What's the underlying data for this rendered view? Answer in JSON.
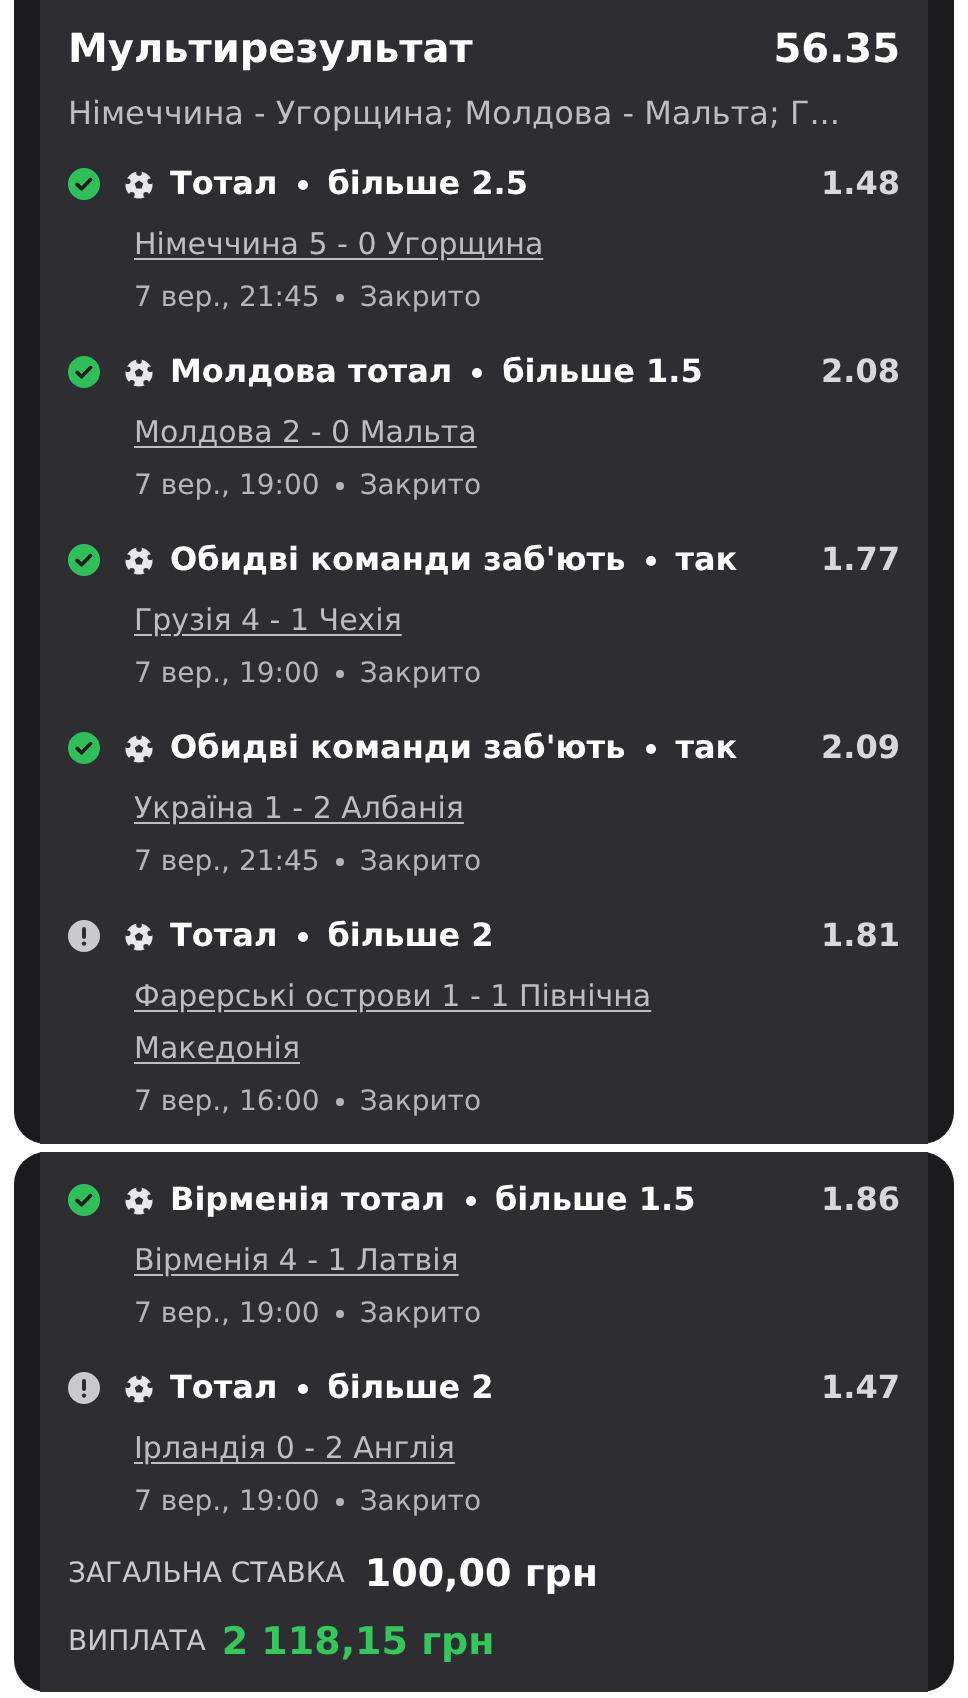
{
  "header": {
    "title": "Мультирезультат",
    "odds": "56.35",
    "subtitle": "Німеччина - Угорщина; Молдова - Мальта; Г..."
  },
  "cards": [
    {
      "selections": [
        {
          "won": true,
          "market": "Тотал",
          "pick": "більше 2.5",
          "odds": "1.48",
          "match": "Німеччина 5 - 0 Угорщина",
          "date": "7 вер., 21:45",
          "state": "Закрито"
        },
        {
          "won": true,
          "market": "Молдова тотал",
          "pick": "більше 1.5",
          "odds": "2.08",
          "match": "Молдова 2 - 0 Мальта",
          "date": "7 вер., 19:00",
          "state": "Закрито"
        },
        {
          "won": true,
          "market": "Обидві команди заб'ють",
          "pick": "так",
          "odds": "1.77",
          "match": "Грузія 4 - 1 Чехія",
          "date": "7 вер., 19:00",
          "state": "Закрито"
        },
        {
          "won": true,
          "market": "Обидві команди заб'ють",
          "pick": "так",
          "odds": "2.09",
          "match": "Україна 1 - 2 Албанія",
          "date": "7 вер., 21:45",
          "state": "Закрито"
        },
        {
          "won": false,
          "market": "Тотал",
          "pick": "більше 2",
          "odds": "1.81",
          "match": "Фарерські острови 1 - 1 Північна Македонія",
          "date": "7 вер., 16:00",
          "state": "Закрито"
        }
      ]
    },
    {
      "selections": [
        {
          "won": true,
          "market": "Вірменія тотал",
          "pick": "більше 1.5",
          "odds": "1.86",
          "match": "Вірменія 4 - 1 Латвія",
          "date": "7 вер., 19:00",
          "state": "Закрито"
        },
        {
          "won": false,
          "market": "Тотал",
          "pick": "більше 2",
          "odds": "1.47",
          "match": "Ірландія 0 - 2 Англія",
          "date": "7 вер., 19:00",
          "state": "Закрито"
        }
      ]
    }
  ],
  "summary": {
    "stake_label": "ЗАГАЛЬНА СТАВКА",
    "stake": "100,00 грн",
    "payout_label": "ВИПЛАТА",
    "payout": "2 118,15 грн"
  }
}
